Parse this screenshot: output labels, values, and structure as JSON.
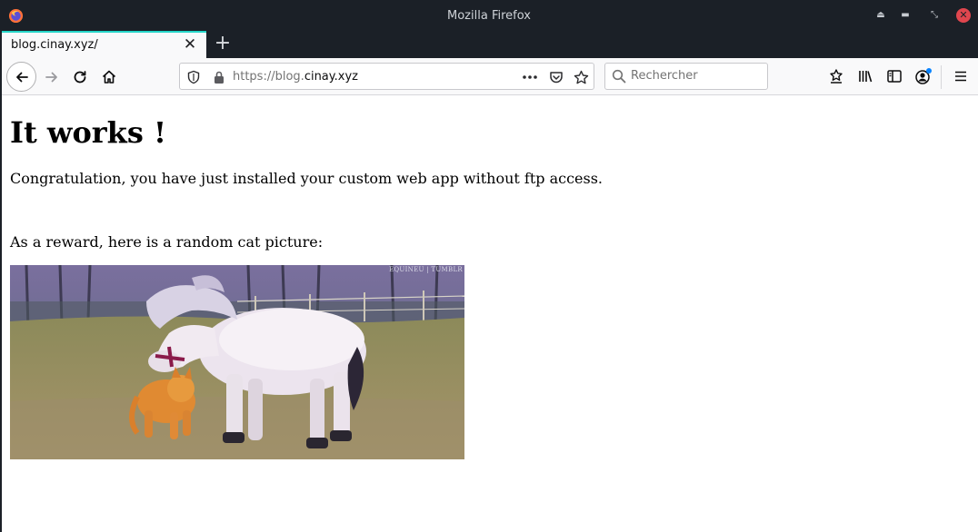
{
  "window": {
    "title": "Mozilla Firefox"
  },
  "tabs": [
    {
      "label": "blog.cinay.xyz/",
      "active": true
    }
  ],
  "navbar": {
    "url_scheme": "https://blog.",
    "url_host": "cinay.xyz",
    "search_placeholder": "Rechercher"
  },
  "icons": {
    "titlebar": [
      "firefox-logo-icon",
      "eject-icon",
      "minimize-icon",
      "restore-icon",
      "close-icon"
    ],
    "navbar": [
      "back-icon",
      "forward-icon",
      "reload-icon",
      "home-icon",
      "shield-icon",
      "lock-icon",
      "more-actions-icon",
      "pocket-icon",
      "bookmark-star-icon",
      "search-icon",
      "bookmarks-menu-icon",
      "library-icon",
      "sidebar-icon",
      "account-icon",
      "hamburger-menu-icon"
    ]
  },
  "colors": {
    "titlebar_bg": "#1b2027",
    "tab_accent": "#25d5c8",
    "close_button": "#e0464e",
    "account_badge": "#0a84ff"
  },
  "page": {
    "heading": "It works !",
    "paragraph1": "Congratulation, you have just installed your custom web app without ftp access.",
    "paragraph2": "As a reward, here is a random cat picture:",
    "image_credit": "EQUINEU | TUMBLR"
  }
}
